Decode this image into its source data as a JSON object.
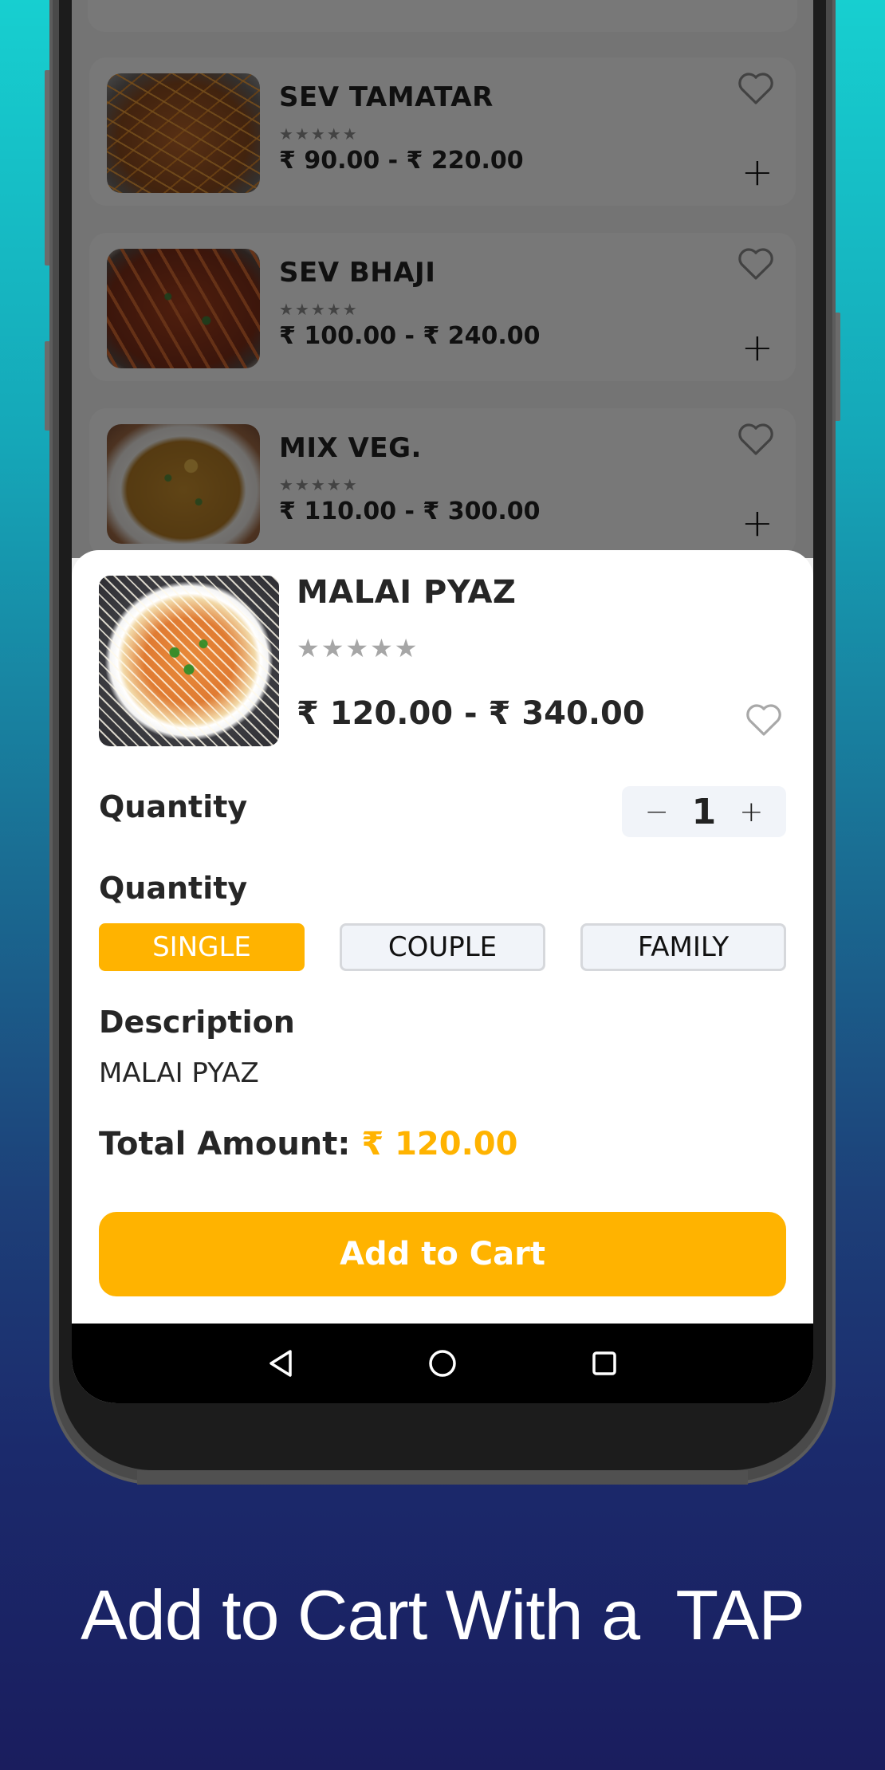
{
  "list": {
    "items": [
      {
        "name": "SEV TAMATAR",
        "rating": 0,
        "rating_max": 5,
        "stars_glyph": "★★★★★",
        "price_range": "₹ 90.00 - ₹ 220.00",
        "image": "sev-tamatar-dish"
      },
      {
        "name": "SEV BHAJI",
        "rating": 0,
        "rating_max": 5,
        "stars_glyph": "★★★★★",
        "price_range": "₹ 100.00 - ₹ 240.00",
        "image": "sev-bhaji-dish"
      },
      {
        "name": "MIX VEG.",
        "rating": 0,
        "rating_max": 5,
        "stars_glyph": "★★★★★",
        "price_range": "₹ 110.00 - ₹ 300.00",
        "image": "mix-veg-dish"
      }
    ],
    "add_icon": "plus-icon",
    "favorite_icon": "heart-outline-icon"
  },
  "sheet": {
    "title": "MALAI PYAZ",
    "image": "malai-pyaz-dish",
    "rating": 0,
    "rating_max": 5,
    "stars_glyph": "★★★★★",
    "price_range": "₹ 120.00 - ₹ 340.00",
    "favorite_icon": "heart-outline-icon",
    "quantity_label": "Quantity",
    "quantity": {
      "decrement": "−",
      "value": "1",
      "increment": "+"
    },
    "size_label": "Quantity",
    "size_options": [
      {
        "label": "SINGLE",
        "selected": true
      },
      {
        "label": "COUPLE",
        "selected": false
      },
      {
        "label": "FAMILY",
        "selected": false
      }
    ],
    "description_label": "Description",
    "description": "MALAI PYAZ",
    "total_label": "Total Amount:",
    "total_value": "₹ 120.00",
    "add_to_cart": "Add to Cart"
  },
  "navbar": {
    "back_icon": "back-triangle-icon",
    "home_icon": "home-circle-icon",
    "recents_icon": "recents-square-icon"
  },
  "caption": "Add to Cart With a  TAP",
  "colors": {
    "accent": "#ffb300",
    "text_primary": "#262626",
    "chip_bg": "#f1f4f9",
    "bg_top": "#17cfd0",
    "bg_bottom": "#1a1d5e"
  }
}
